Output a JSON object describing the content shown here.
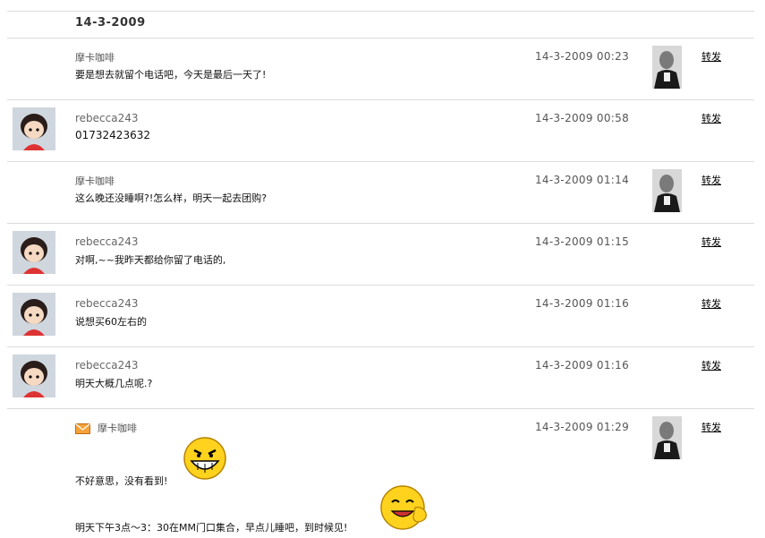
{
  "date_header": "14-3-2009",
  "forward_label": "转发",
  "messages": [
    {
      "sender": "摩卡咖啡",
      "text": "要是想去就留个电话吧，今天是最后一天了!",
      "time": "14-3-2009 00:23",
      "avatar": "man-photo"
    },
    {
      "sender": "rebecca243",
      "text": "01732423632",
      "time": "14-3-2009 00:58",
      "avatar": "cartoon-girl"
    },
    {
      "sender": "摩卡咖啡",
      "text": "这么晚还没睡啊?!怎么样，明天一起去团购?",
      "time": "14-3-2009 01:14",
      "avatar": "man-photo"
    },
    {
      "sender": "rebecca243",
      "text": "对啊,~~我昨天都给你留了电话的,",
      "time": "14-3-2009 01:15",
      "avatar": "cartoon-girl"
    },
    {
      "sender": "rebecca243",
      "text": "说想买60左右的",
      "time": "14-3-2009 01:16",
      "avatar": "cartoon-girl"
    },
    {
      "sender": "rebecca243",
      "text": "明天大概几点呢.?",
      "time": "14-3-2009 01:16",
      "avatar": "cartoon-girl"
    },
    {
      "sender": "摩卡咖啡",
      "text": "不好意思，没有看到!",
      "text2": "明天下午3点～3：30在MM门口集合，早点儿睡吧，到时候见!",
      "time": "14-3-2009 01:29",
      "avatar": "man-photo",
      "icon": "envelope-icon"
    }
  ]
}
